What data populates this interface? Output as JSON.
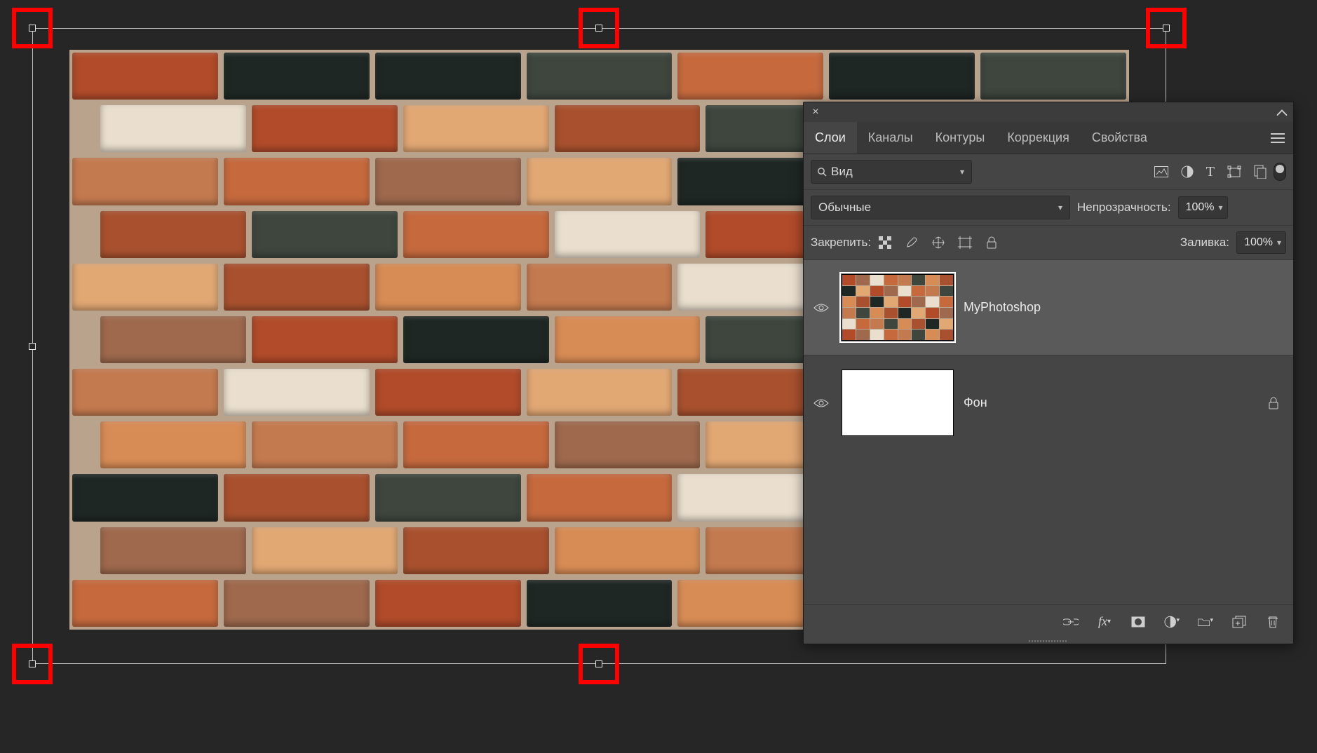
{
  "panel": {
    "tabs": [
      {
        "label": "Слои",
        "active": true
      },
      {
        "label": "Каналы",
        "active": false
      },
      {
        "label": "Контуры",
        "active": false
      },
      {
        "label": "Коррекция",
        "active": false
      },
      {
        "label": "Свойства",
        "active": false
      }
    ],
    "filter_kind": "Вид",
    "blend_mode": "Обычные",
    "opacity_label": "Непрозрачность:",
    "opacity_value": "100%",
    "lock_label": "Закрепить:",
    "fill_label": "Заливка:",
    "fill_value": "100%"
  },
  "layers": [
    {
      "name": "MyPhotoshop",
      "visible": true,
      "selected": true,
      "thumb": "brick",
      "locked": false
    },
    {
      "name": "Фон",
      "visible": true,
      "selected": false,
      "thumb": "white",
      "locked": true
    }
  ],
  "transform_handles": [
    {
      "pos": "top-left",
      "highlighted": true
    },
    {
      "pos": "top-center",
      "highlighted": true
    },
    {
      "pos": "top-right",
      "highlighted": true
    },
    {
      "pos": "mid-left",
      "highlighted": false
    },
    {
      "pos": "bottom-left",
      "highlighted": true
    },
    {
      "pos": "bottom-center",
      "highlighted": true
    }
  ],
  "brick_palette": [
    "#b14b2a",
    "#c66a3e",
    "#d88c55",
    "#e2a874",
    "#eadfce",
    "#3e463e",
    "#1f2724",
    "#9e694d",
    "#c47a4f",
    "#a9512e"
  ]
}
